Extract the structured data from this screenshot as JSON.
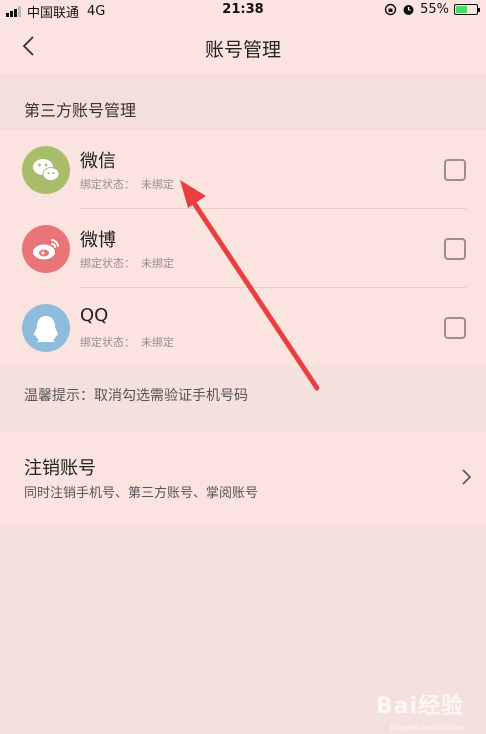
{
  "status_bar": {
    "carrier": "中国联通",
    "network": "4G",
    "time": "21:38",
    "battery": "55%",
    "battery_level": 0.55
  },
  "header": {
    "title": "账号管理"
  },
  "section": {
    "title": "第三方账号管理"
  },
  "accounts": [
    {
      "name": "微信",
      "status_label": "绑定状态：",
      "status_value": "未绑定",
      "color": "#a9be6a",
      "icon": "wechat-icon"
    },
    {
      "name": "微博",
      "status_label": "绑定状态：",
      "status_value": "未绑定",
      "color": "#ea7579",
      "icon": "weibo-icon"
    },
    {
      "name": "QQ",
      "status_label": "绑定状态：",
      "status_value": "未绑定",
      "color": "#8fbbdc",
      "icon": "qq-icon"
    }
  ],
  "tip": "温馨提示：取消勾选需验证手机号码",
  "cancel_account": {
    "title": "注销账号",
    "subtitle": "同时注销手机号、第三方账号、掌阅账号"
  },
  "watermark": {
    "text": "Bai经验",
    "sub": "jingyan.baidu.com"
  },
  "colors": {
    "background": "#f4e0dc",
    "annotation_arrow": "#e8403f"
  }
}
